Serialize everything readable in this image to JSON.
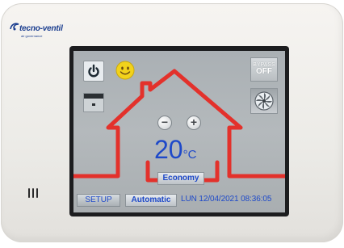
{
  "brand": {
    "name": "tecno-ventil",
    "tagline": "air governance"
  },
  "screen": {
    "bypass_label": "BYPASS",
    "bypass_state": "OFF",
    "temperature": "20",
    "temperature_unit": "°C",
    "mode_label": "Economy",
    "setup_label": "SETUP",
    "auto_label": "Automatic",
    "day": "LUN",
    "date": "12/04/2021",
    "time": "08:36:05"
  },
  "icons": [
    "power-icon",
    "smiley-icon",
    "fan-speed-icon",
    "fan-icon",
    "minus-icon",
    "plus-icon",
    "house-outline"
  ],
  "colors": {
    "screen_bg": "#b0b5b8",
    "house_line": "#e3312b",
    "text_blue": "#1e49c9",
    "bezel": "#1c1d1f",
    "smiley": "#f2d21b"
  }
}
